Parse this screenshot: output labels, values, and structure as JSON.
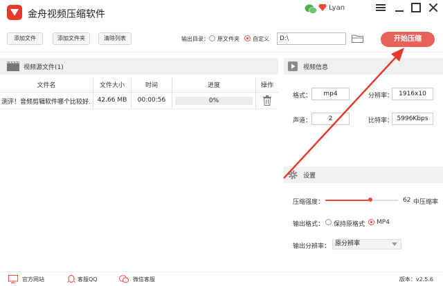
{
  "app": {
    "title": "金舟视频压缩软件",
    "username": "Lyan"
  },
  "toolbar": {
    "add_file": "添加文件",
    "add_folder": "添加文件夹",
    "clear_list": "清除列表",
    "output_label": "输出目录：",
    "opt_source": "原文件夹",
    "opt_custom": "自定义",
    "selected_option": "自定义",
    "path_value": "D:\\",
    "start": "开始压缩"
  },
  "file_list": {
    "title": "视频源文件(1)",
    "columns": [
      "文件名",
      "文件大小",
      "时间",
      "进度",
      "操作"
    ],
    "rows": [
      {
        "name": "测评！音频剪辑软件哪个比较好...",
        "size": "42.66 MB",
        "time": "00:00:56",
        "progress": "0%",
        "progress_value": 0
      }
    ]
  },
  "video_info": {
    "title": "视频信息",
    "format_label": "格式：",
    "format_value": "mp4",
    "resolution_label": "分辨率：",
    "resolution_value": "1916x10",
    "channels_label": "声道：",
    "channels_value": "2",
    "bitrate_label": "比特率：",
    "bitrate_value": "5996Kbps"
  },
  "settings": {
    "title": "设置",
    "strength_label": "压缩强度：",
    "strength_value": "62",
    "strength_level": 0.62,
    "strength_text": "中压缩率",
    "format_label": "输出格式：",
    "format_keep": "保持原格式",
    "format_mp4": "MP4",
    "format_selected": "MP4",
    "resolution_label": "输出分辨率：",
    "resolution_value": "原分辨率"
  },
  "footer": {
    "website": "官方网站",
    "qq": "客服QQ",
    "wechat": "微信客服",
    "version": "版本：v2.5.6"
  },
  "colors": {
    "accent": "#e84a3c",
    "start_button": "#e8625a",
    "arrow": "#e53a2e",
    "logo": "#e8392d"
  }
}
